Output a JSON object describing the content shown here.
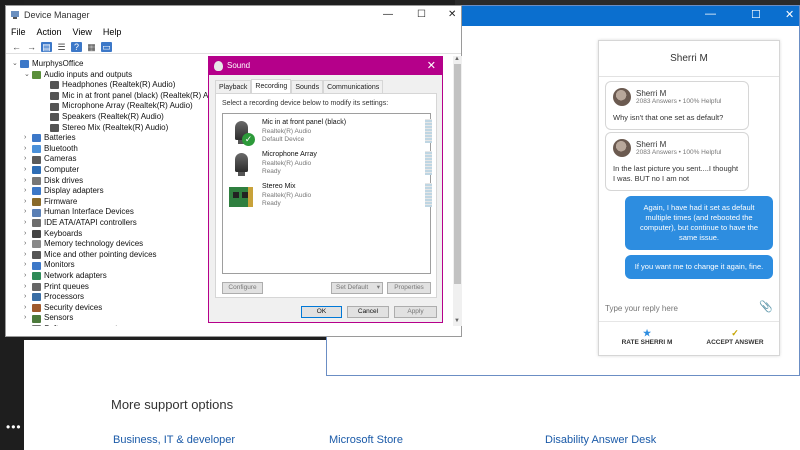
{
  "device_manager": {
    "title": "Device Manager",
    "menu": [
      "File",
      "Action",
      "View",
      "Help"
    ],
    "computer": "MurphysOffice",
    "audio_group": "Audio inputs and outputs",
    "audio_children": [
      "Headphones (Realtek(R) Audio)",
      "Mic in at front panel (black) (Realtek(R) Audio)",
      "Microphone Array (Realtek(R) Audio)",
      "Speakers (Realtek(R) Audio)",
      "Stereo Mix (Realtek(R) Audio)"
    ],
    "categories": [
      "Batteries",
      "Bluetooth",
      "Cameras",
      "Computer",
      "Disk drives",
      "Display adapters",
      "Firmware",
      "Human Interface Devices",
      "IDE ATA/ATAPI controllers",
      "Keyboards",
      "Memory technology devices",
      "Mice and other pointing devices",
      "Monitors",
      "Network adapters",
      "Print queues",
      "Processors",
      "Security devices",
      "Sensors",
      "Software components"
    ]
  },
  "sound": {
    "title": "Sound",
    "tabs": [
      "Playback",
      "Recording",
      "Sounds",
      "Communications"
    ],
    "instruction": "Select a recording device below to modify its settings:",
    "devices": [
      {
        "name": "Mic in at front panel (black)",
        "driver": "Realtek(R) Audio",
        "status": "Default Device"
      },
      {
        "name": "Microphone Array",
        "driver": "Realtek(R) Audio",
        "status": "Ready"
      },
      {
        "name": "Stereo Mix",
        "driver": "Realtek(R) Audio",
        "status": "Ready"
      }
    ],
    "buttons": {
      "configure": "Configure",
      "set_default": "Set Default",
      "properties": "Properties",
      "ok": "OK",
      "cancel": "Cancel",
      "apply": "Apply"
    }
  },
  "chat": {
    "agent": "Sherri M",
    "meta": "2083 Answers • 100% Helpful",
    "messages": [
      {
        "from": "agent",
        "text": "Why isn't that one set as default?"
      },
      {
        "from": "agent",
        "text": "In the last picture you sent....I thought I was. BUT no I am not"
      },
      {
        "from": "user",
        "text": "Again, I have had it set as default multiple times (and rebooted the computer), but continue to have the same issue."
      },
      {
        "from": "user",
        "text": "If you want me to change it again, fine."
      }
    ],
    "reply_placeholder": "Type your reply here",
    "rate_label": "RATE SHERRI M",
    "accept_label": "ACCEPT ANSWER"
  },
  "support_page": {
    "heading": "More support options",
    "links": [
      "Business, IT & developer",
      "Microsoft Store",
      "Disability Answer Desk"
    ]
  },
  "colors": {
    "sound_accent": "#b5008a",
    "help_titlebar": "#0b6fcf",
    "chat_bubble_user": "#2d8de0"
  }
}
